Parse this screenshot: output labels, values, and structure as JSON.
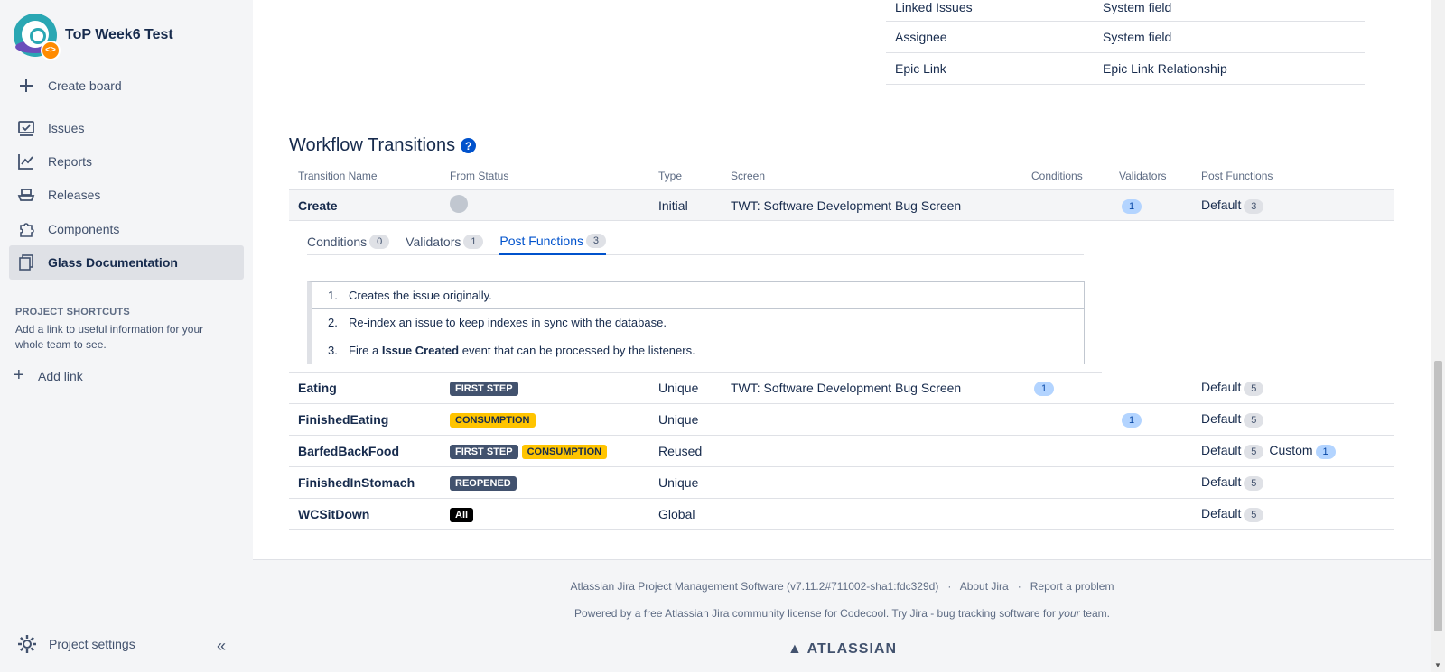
{
  "project": {
    "name": "ToP Week6 Test",
    "badge": "<>"
  },
  "nav": {
    "create_board": "Create board",
    "items": [
      {
        "label": "Issues"
      },
      {
        "label": "Reports"
      },
      {
        "label": "Releases"
      },
      {
        "label": "Components"
      },
      {
        "label": "Glass Documentation"
      }
    ],
    "shortcuts_heading": "PROJECT SHORTCUTS",
    "shortcuts_desc": "Add a link to useful information for your whole team to see.",
    "add_link": "Add link",
    "project_settings": "Project settings",
    "collapse": "«"
  },
  "fields": [
    {
      "name": "Linked Issues",
      "type": "System field"
    },
    {
      "name": "Assignee",
      "type": "System field"
    },
    {
      "name": "Epic Link",
      "type": "Epic Link Relationship"
    }
  ],
  "workflow": {
    "title": "Workflow Transitions",
    "help": "?",
    "headers": {
      "name": "Transition Name",
      "from": "From Status",
      "type": "Type",
      "screen": "Screen",
      "conditions": "Conditions",
      "validators": "Validators",
      "post": "Post Functions"
    },
    "rows": [
      {
        "name": "Create",
        "type": "Initial",
        "screen": "TWT: Software Development Bug Screen",
        "validators": "1",
        "post_label": "Default",
        "post_count": "3"
      },
      {
        "name": "Eating",
        "from": [
          "FIRST STEP"
        ],
        "type": "Unique",
        "screen": "TWT: Software Development Bug Screen",
        "conditions": "1",
        "post_label": "Default",
        "post_count": "5"
      },
      {
        "name": "FinishedEating",
        "from": [
          "CONSUMPTION"
        ],
        "type": "Unique",
        "validators": "1",
        "post_label": "Default",
        "post_count": "5"
      },
      {
        "name": "BarfedBackFood",
        "from": [
          "FIRST STEP",
          "CONSUMPTION"
        ],
        "type": "Reused",
        "post_label": "Default",
        "post_count": "5",
        "custom_label": "Custom",
        "custom_count": "1"
      },
      {
        "name": "FinishedInStomach",
        "from": [
          "REOPENED"
        ],
        "type": "Unique",
        "post_label": "Default",
        "post_count": "5"
      },
      {
        "name": "WCSitDown",
        "from": [
          "All"
        ],
        "type": "Global",
        "post_label": "Default",
        "post_count": "5"
      }
    ],
    "detail": {
      "tabs": [
        {
          "label": "Conditions",
          "count": "0"
        },
        {
          "label": "Validators",
          "count": "1"
        },
        {
          "label": "Post Functions",
          "count": "3"
        }
      ],
      "post_functions": [
        {
          "num": "1.",
          "text": "Creates the issue originally."
        },
        {
          "num": "2.",
          "text": "Re-index an issue to keep indexes in sync with the database."
        },
        {
          "num": "3.",
          "pre": "Fire a ",
          "bold": "Issue Created",
          "post": " event that can be processed by the listeners."
        }
      ]
    }
  },
  "footer": {
    "software": "Atlassian Jira Project Management Software (v7.11.2#711002-sha1:fdc329d)",
    "sep": "·",
    "about": "About Jira",
    "report": "Report a problem",
    "powered_pre": "Powered by a free Atlassian Jira community license for Codecool. Try Jira - bug tracking software for ",
    "powered_em": "your",
    "powered_post": " team.",
    "logo": "ATLASSIAN"
  },
  "colors": {
    "accent": "#0052cc",
    "sidebar_bg": "#f4f5f7",
    "lozenge_dark": "#42526e",
    "lozenge_yellow": "#ffc400"
  }
}
